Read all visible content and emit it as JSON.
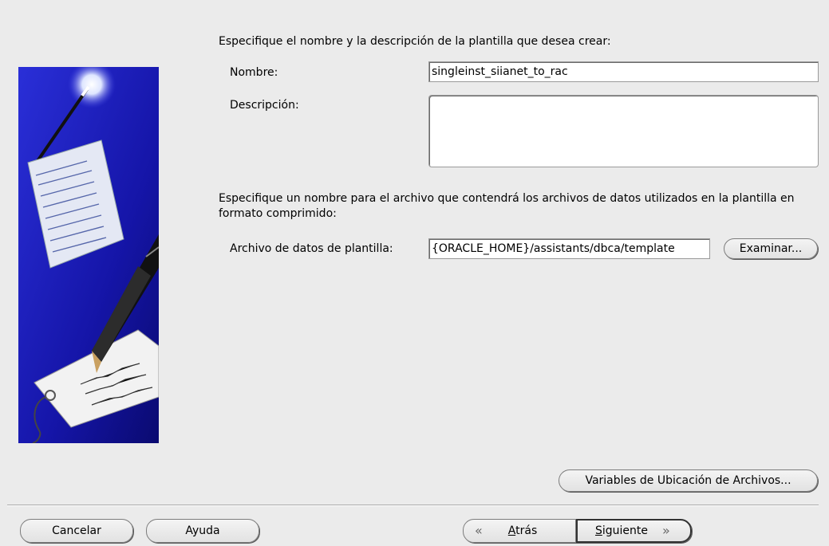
{
  "form": {
    "intro": "Especifique el nombre y la descripción de la plantilla que desea crear:",
    "name_label": "Nombre:",
    "name_value": "singleinst_siianet_to_rac",
    "description_label": "Descripción:",
    "description_value": "",
    "datafile_intro": "Especifique un nombre para el archivo que contendrá los archivos de datos utilizados en la plantilla en formato comprimido:",
    "datafile_label": "Archivo de datos de plantilla:",
    "datafile_value": "{ORACLE_HOME}/assistants/dbca/template",
    "browse_label": "Examinar...",
    "file_location_vars_label": "Variables de Ubicación de Archivos..."
  },
  "footer": {
    "cancel_label": "Cancelar",
    "help_label": "Ayuda",
    "back_mnemonic": "A",
    "back_rest": "trás",
    "next_mnemonic": "S",
    "next_rest": "iguiente"
  },
  "icons": {
    "back": "chevron-double-left-icon",
    "next": "chevron-double-right-icon",
    "banner": "wizard-illustration"
  },
  "colors": {
    "background": "#ebebeb",
    "banner_blue": "#1a1fb0"
  }
}
